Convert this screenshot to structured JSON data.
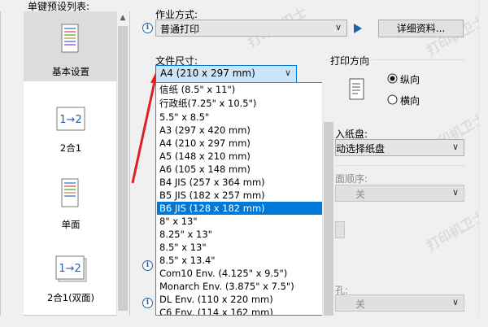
{
  "preset_list": {
    "title": "单键预设列表:",
    "items": [
      {
        "label": "基本设置",
        "selected": true,
        "icon": "document-icon"
      },
      {
        "label": "2合1",
        "selected": false,
        "icon": "two-in-one-icon"
      },
      {
        "label": "单面",
        "selected": false,
        "icon": "single-sided-icon"
      },
      {
        "label": "2合1(双面)",
        "selected": false,
        "icon": "two-in-one-duplex-icon"
      }
    ]
  },
  "job_type": {
    "label": "作业方式:",
    "value": "普通打印",
    "details_button": "详细资料..."
  },
  "paper_size": {
    "label": "文件尺寸:",
    "value": "A4 (210 x 297 mm)",
    "options": [
      "信纸 (8.5\" x 11\")",
      "行政纸(7.25\" x 10.5\")",
      "5.5\" x 8.5\"",
      "A3 (297 x 420 mm)",
      "A4 (210 x 297 mm)",
      "A5 (148 x 210 mm)",
      "A6 (105 x 148 mm)",
      "B4 JIS (257 x 364 mm)",
      "B5 JIS (182 x 257 mm)",
      "B6 JIS (128 x 182 mm)",
      "8\" x 13\"",
      "8.25\" x 13\"",
      "8.5\" x 13\"",
      "8.5\" x 13.4\"",
      "Com10 Env. (4.125\" x 9.5\")",
      "Monarch Env. (3.875\" x 7.5\")",
      "DL Env. (110 x 220 mm)",
      "C6 Env. (114 x 162 mm)"
    ],
    "highlighted_option": "B6 JIS (128 x 182 mm)"
  },
  "orientation": {
    "label": "打印方向",
    "options": [
      "纵向",
      "横向"
    ],
    "selected": "纵向"
  },
  "paper_source": {
    "label_fragment": "入纸盘:",
    "value_fragment": "动选择纸盘"
  },
  "page_order": {
    "label_fragment": "面顺序:",
    "value": "关"
  },
  "staple": {
    "label_fragment": "孔:",
    "value": "关"
  },
  "watermark_text": "打印机卫士",
  "colors": {
    "selection": "#0078d7",
    "arrow": "#e02020",
    "accent": "#1e63b0"
  }
}
